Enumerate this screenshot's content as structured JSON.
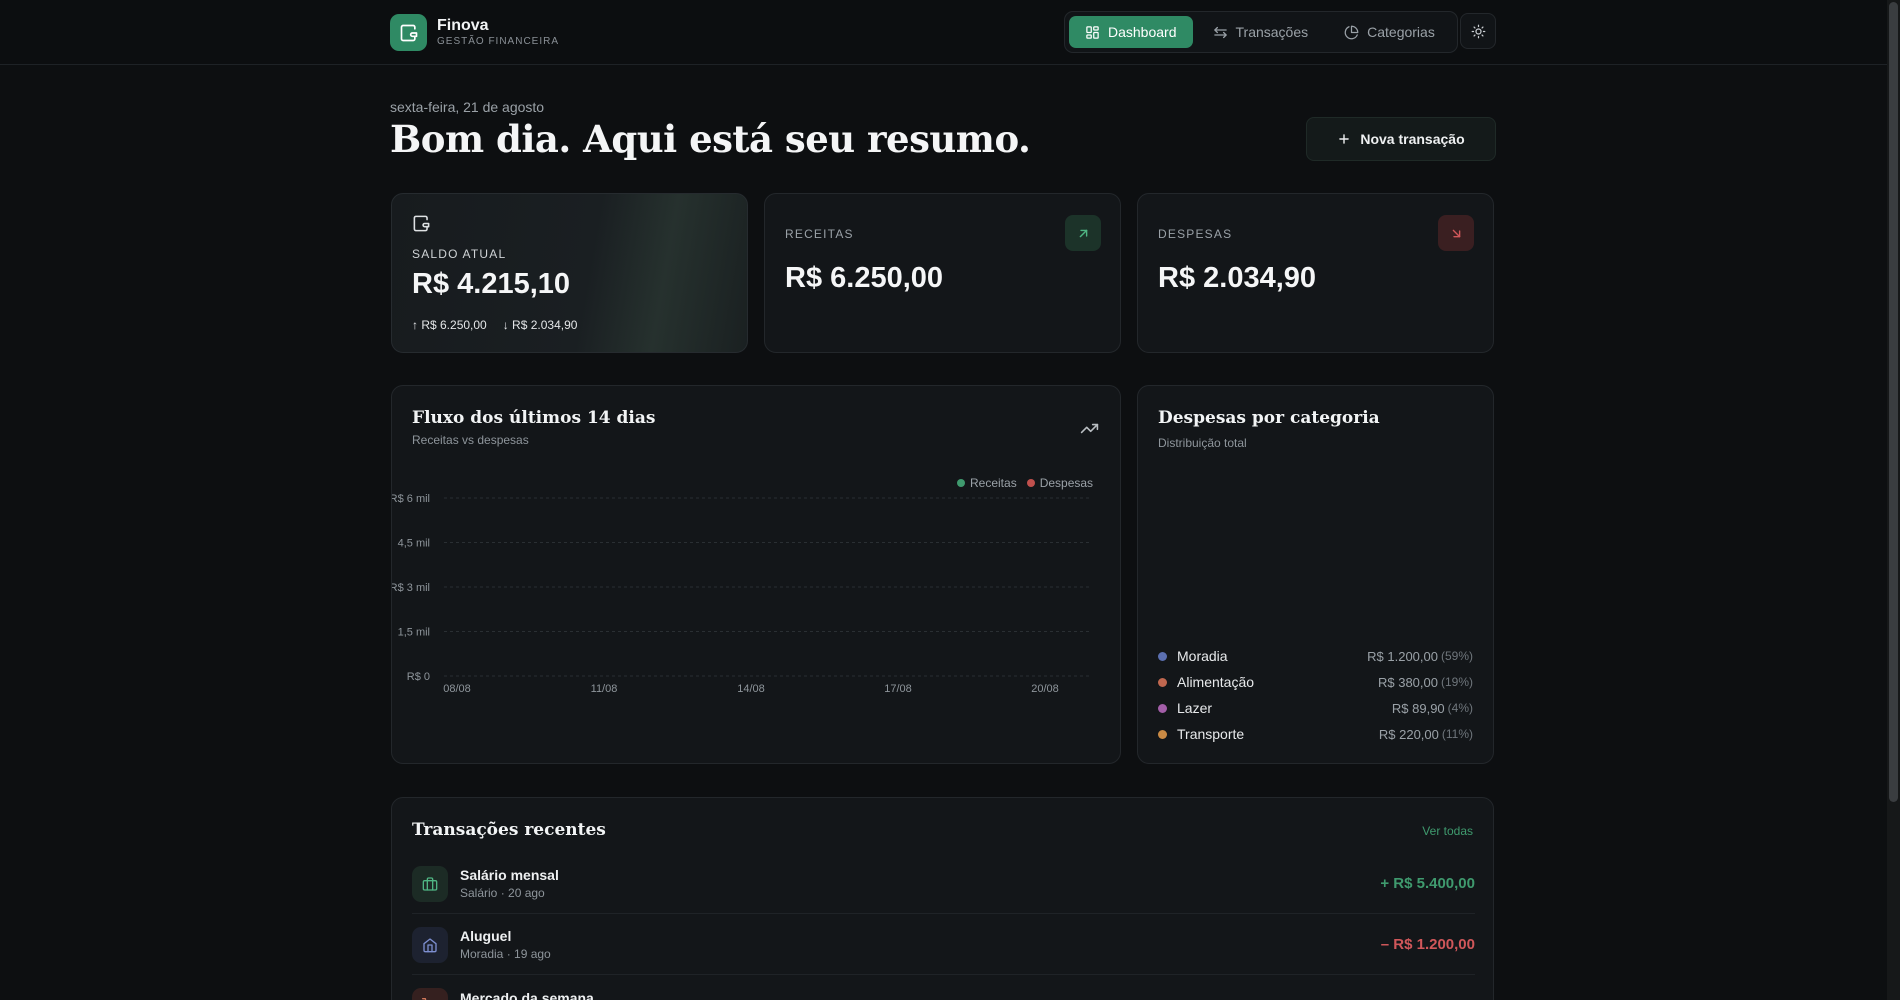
{
  "brand": {
    "name": "Finova",
    "subtitle": "GESTÃO FINANCEIRA"
  },
  "nav": {
    "items": [
      {
        "label": "Dashboard",
        "active": true,
        "icon": "grid-icon"
      },
      {
        "label": "Transações",
        "active": false,
        "icon": "arrows-swap-icon"
      },
      {
        "label": "Categorias",
        "active": false,
        "icon": "pie-chart-icon"
      }
    ],
    "theme_icon": "sun-icon"
  },
  "header": {
    "date": "sexta-feira, 21 de agosto",
    "title": "Bom dia. Aqui está seu resumo.",
    "new_button": "Nova transação"
  },
  "summary": {
    "balance": {
      "label": "SALDO ATUAL",
      "value": "R$ 4.215,10",
      "income": "↑ R$ 6.250,00",
      "expense": "↓ R$ 2.034,90"
    },
    "income": {
      "label": "RECEITAS",
      "value": "R$ 6.250,00"
    },
    "expense": {
      "label": "DESPESAS",
      "value": "R$ 2.034,90"
    }
  },
  "flow": {
    "title": "Fluxo dos últimos 14 dias",
    "subtitle": "Receitas vs despesas"
  },
  "chart_data": {
    "type": "bar",
    "title": "Fluxo dos últimos 14 dias",
    "subtitle": "Receitas vs despesas",
    "x_ticks": [
      "08/08",
      "11/08",
      "14/08",
      "17/08",
      "20/08"
    ],
    "y_ticks": [
      "R$ 0",
      "1,5 mil",
      "R$ 3 mil",
      "4,5 mil",
      "R$ 6 mil"
    ],
    "ylim": [
      0,
      6000
    ],
    "series": [
      {
        "name": "Receitas",
        "color": "#3f9a6e",
        "values": []
      },
      {
        "name": "Despesas",
        "color": "#c0504d",
        "values": []
      }
    ],
    "legend": "top-right",
    "grid": true
  },
  "categories_panel": {
    "title": "Despesas por categoria",
    "subtitle": "Distribuição total",
    "items": [
      {
        "name": "Moradia",
        "value": "R$ 1.200,00",
        "pct": "(59%)",
        "color": "#5b6fb0"
      },
      {
        "name": "Alimentação",
        "value": "R$ 380,00",
        "pct": "(19%)",
        "color": "#c0674f"
      },
      {
        "name": "Lazer",
        "value": "R$ 89,90",
        "pct": "(4%)",
        "color": "#a35ea8"
      },
      {
        "name": "Transporte",
        "value": "R$ 220,00",
        "pct": "(11%)",
        "color": "#c98a44"
      }
    ]
  },
  "transactions": {
    "title": "Transações recentes",
    "see_all": "Ver todas",
    "items": [
      {
        "name": "Salário mensal",
        "meta": "Salário · 20 ago",
        "amount": "+ R$ 5.400,00",
        "type": "income",
        "icon": "briefcase-icon"
      },
      {
        "name": "Aluguel",
        "meta": "Moradia · 19 ago",
        "amount": "– R$ 1.200,00",
        "type": "expense",
        "icon": "home-icon"
      },
      {
        "name": "Mercado da semana",
        "meta": "",
        "amount": "",
        "type": "expense",
        "icon": "cart-icon"
      }
    ]
  },
  "colors": {
    "accent": "#2f8a64",
    "income": "#3f9a6e",
    "expense": "#c0504d",
    "background": "#0d0f11",
    "card": "#131619"
  }
}
